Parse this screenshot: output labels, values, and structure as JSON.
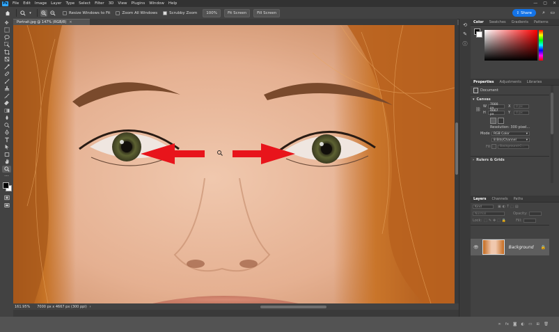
{
  "menu": {
    "logo": "Ps",
    "items": [
      "File",
      "Edit",
      "Image",
      "Layer",
      "Type",
      "Select",
      "Filter",
      "3D",
      "View",
      "Plugins",
      "Window",
      "Help"
    ]
  },
  "window_controls": {
    "minimize": "—",
    "maximize": "▢",
    "close": "✕"
  },
  "options_bar": {
    "resize_windows_label": "Resize Windows to Fit",
    "resize_windows_checked": false,
    "zoom_all_label": "Zoom All Windows",
    "zoom_all_checked": false,
    "scrubby_zoom_label": "Scrubby Zoom",
    "scrubby_zoom_checked": true,
    "zoom_100_label": "100%",
    "fit_screen_label": "Fit Screen",
    "fill_screen_label": "Fill Screen",
    "share_label": "Share"
  },
  "document": {
    "tab_title": "Portrait.jpg @ 147% (RGB/8)",
    "tab_close": "×"
  },
  "status_bar": {
    "zoom": "161.95%",
    "doc_size": "7000 px x 4667 px (300 ppi)",
    "arrow": "›"
  },
  "color_panel": {
    "tabs": [
      "Color",
      "Swatches",
      "Gradients",
      "Patterns"
    ],
    "foreground": "#000000",
    "background": "#ffffff",
    "hue_color": "#ff0000"
  },
  "properties_panel": {
    "tabs": [
      "Properties",
      "Adjustments",
      "Libraries"
    ],
    "doc_label": "Document",
    "canvas_section": "Canvas",
    "w_label": "W",
    "w_value": "7000 px",
    "x_label": "X",
    "x_value": "0 px",
    "h_label": "H",
    "h_value": "4667 px",
    "y_label": "Y",
    "y_value": "0 px",
    "resolution": "Resolution: 300 pixel...",
    "mode_label": "Mode",
    "mode_value": "RGB Color",
    "depth_value": "8 Bits/Channel",
    "fill_label": "Fill",
    "fill_value": "Background C...",
    "rulers_section": "Rulers & Grids"
  },
  "layers_panel": {
    "tabs": [
      "Layers",
      "Channels",
      "Paths"
    ],
    "kind_label": "Kind",
    "blend_mode": "Normal",
    "opacity_label": "Opacity:",
    "lock_label": "Lock:",
    "fill_label": "Fill:",
    "layer_name": "Background"
  },
  "colors": {
    "accent": "#1473e6",
    "arrow_red": "#e8141b"
  }
}
